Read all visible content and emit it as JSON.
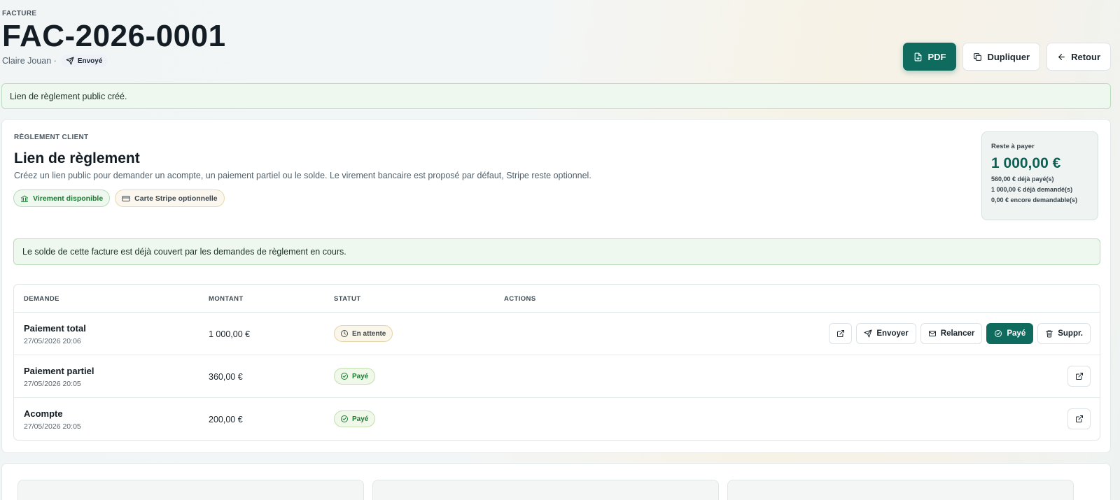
{
  "header": {
    "eyebrow": "FACTURE",
    "invoice_number": "FAC-2026-0001",
    "client": "Claire Jouan ·",
    "status_badge": "Envoyé"
  },
  "toolbar": {
    "pdf_label": "PDF",
    "duplicate_label": "Dupliquer",
    "back_label": "Retour"
  },
  "flash_message": "Lien de règlement public créé.",
  "payment_card": {
    "eyebrow": "RÈGLEMENT CLIENT",
    "title": "Lien de règlement",
    "description": "Créez un lien public pour demander un acompte, un paiement partiel ou le solde. Le virement bancaire est proposé par défaut, Stripe reste optionnel.",
    "chips": {
      "transfer": "Virement disponible",
      "stripe": "Carte Stripe optionnelle"
    },
    "balance": {
      "label": "Reste à payer",
      "amount": "1 000,00 €",
      "paid": "560,00 € déjà payé(s)",
      "requested": "1 000,00 € déjà demandé(s)",
      "requestable": "0,00 € encore demandable(s)"
    },
    "info_message": "Le solde de cette facture est déjà couvert par les demandes de règlement en cours.",
    "table": {
      "columns": [
        "DEMANDE",
        "MONTANT",
        "STATUT",
        "ACTIONS"
      ],
      "rows": [
        {
          "name": "Paiement total",
          "date": "27/05/2026 20:06",
          "amount": "1 000,00 €",
          "status": "En attente"
        },
        {
          "name": "Paiement partiel",
          "date": "27/05/2026 20:05",
          "amount": "360,00 €",
          "status": "Payé"
        },
        {
          "name": "Acompte",
          "date": "27/05/2026 20:05",
          "amount": "200,00 €",
          "status": "Payé"
        }
      ],
      "row_actions": {
        "send": "Envoyer",
        "remind": "Relancer",
        "mark_paid": "Payé",
        "delete": "Suppr."
      }
    }
  },
  "colors": {
    "accent": "#0f6b5e",
    "success_bg": "#eef8ee",
    "success_text": "#1f7a33",
    "pending_border": "#e6d3a6"
  }
}
